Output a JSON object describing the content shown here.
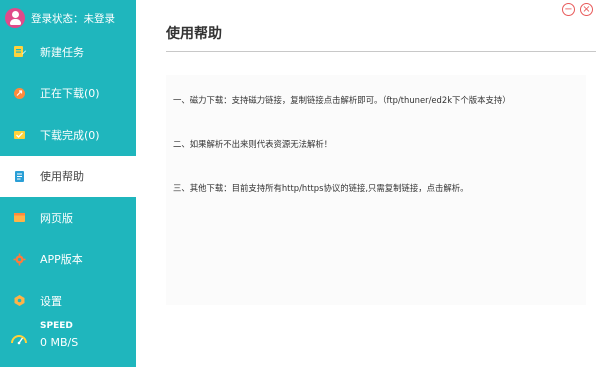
{
  "sidebar": {
    "login_status": "登录状态：未登录",
    "items": [
      {
        "label": "新建任务",
        "icon": "new-task-icon",
        "color": "#ffd23c"
      },
      {
        "label": "正在下载(0)",
        "icon": "downloading-icon",
        "color": "#ff8a3c"
      },
      {
        "label": "下载完成(0)",
        "icon": "download-complete-icon",
        "color": "#ffd23c"
      },
      {
        "label": "使用帮助",
        "icon": "help-document-icon",
        "color": "#2a9fd6",
        "active": true
      },
      {
        "label": "网页版",
        "icon": "web-version-icon",
        "color": "#ffb347"
      },
      {
        "label": "APP版本",
        "icon": "app-version-icon",
        "color": "#ff7a3c"
      },
      {
        "label": "设置",
        "icon": "settings-icon",
        "color": "#ffb347"
      }
    ],
    "speed_label": "SPEED",
    "speed_value": "0 MB/S"
  },
  "main": {
    "title": "使用帮助",
    "paragraphs": [
      "一、磁力下载：支持磁力链接，复制链接点击解析即可。（ftp/thuner/ed2k下个版本支持）",
      "二、如果解析不出来则代表资源无法解析！",
      "三、其他下载：目前支持所有http/https协议的链接,只需复制链接，点击解析。"
    ]
  },
  "window": {
    "minimize_glyph": "−",
    "close_glyph": "×",
    "accent_color": "#e85a5a"
  },
  "colors": {
    "sidebar_bg": "#1fb6bd",
    "avatar_bg": "#e04a8a"
  }
}
